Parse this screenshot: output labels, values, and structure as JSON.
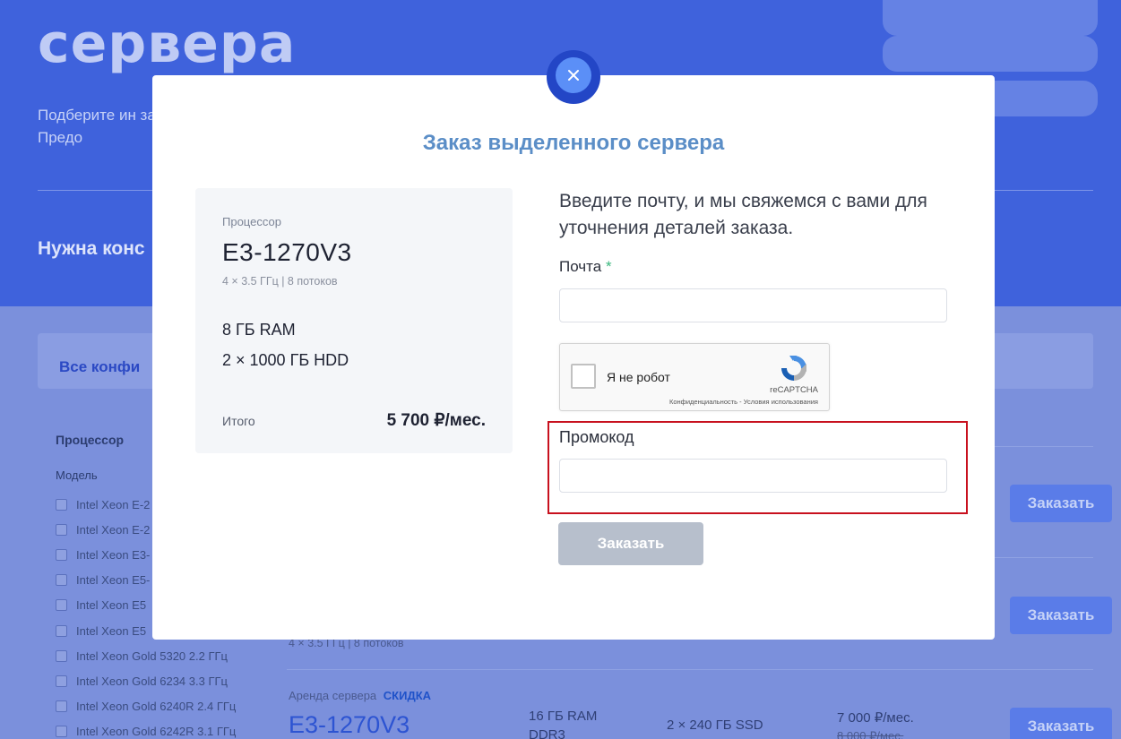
{
  "background": {
    "hero_title": "сервера",
    "hero_description": "Подберите ин задачи. Предо",
    "consult_text": "Нужна конс",
    "filter_tab": "Все конфи",
    "sidebar_title": "Процессор",
    "sidebar_subtitle": "Модель",
    "sidebar_items": [
      "Intel Xeon E-2",
      "Intel Xeon E-2",
      "Intel Xeon E3-",
      "Intel Xeon E5-",
      "Intel Xeon E5",
      "Intel Xeon E5",
      "Intel Xeon Gold 5320 2.2 ГГц",
      "Intel Xeon Gold 6234 3.3 ГГц",
      "Intel Xeon Gold 6240R 2.4 ГГц",
      "Intel Xeon Gold 6242R 3.1 ГГц"
    ],
    "order_button_label": "Заказать",
    "row_partial_spec": "4 × 3.5 ГГц | 8 потоков",
    "row3": {
      "tag": "Аренда сервера",
      "discount": "СКИДКА",
      "model": "E3-1270V3",
      "ram": "16 ГБ RAM",
      "ram_type": "DDR3",
      "storage": "2 × 240 ГБ SSD",
      "price": "7 000 ₽/мес.",
      "old_price": "8 000 ₽/мес."
    }
  },
  "modal": {
    "title": "Заказ выделенного сервера",
    "close_icon": "close-icon",
    "summary": {
      "cpu_label": "Процессор",
      "cpu_model": "E3-1270V3",
      "cpu_spec": "4 × 3.5 ГГц | 8 потоков",
      "ram": "8 ГБ RAM",
      "storage": "2 × 1000 ГБ HDD",
      "total_label": "Итого",
      "total_value": "5 700 ₽/мес."
    },
    "form": {
      "intro": "Введите почту, и мы свяжемся с вами для уточнения деталей заказа.",
      "email_label": "Почта",
      "required_mark": "*",
      "email_value": "",
      "captcha_label": "Я не робот",
      "captcha_brand": "reCAPTCHA",
      "captcha_links": "Конфиденциальность - Условия использования",
      "promo_label": "Промокод",
      "promo_value": "",
      "submit_label": "Заказать"
    }
  },
  "colors": {
    "hero_bg": "#3f62dc",
    "accent_title": "#5b8ec7",
    "close_button": "#5b8ff7",
    "submit_disabled": "#b7bfcc",
    "highlight_frame": "#c8111e",
    "required": "#3bb77e"
  }
}
